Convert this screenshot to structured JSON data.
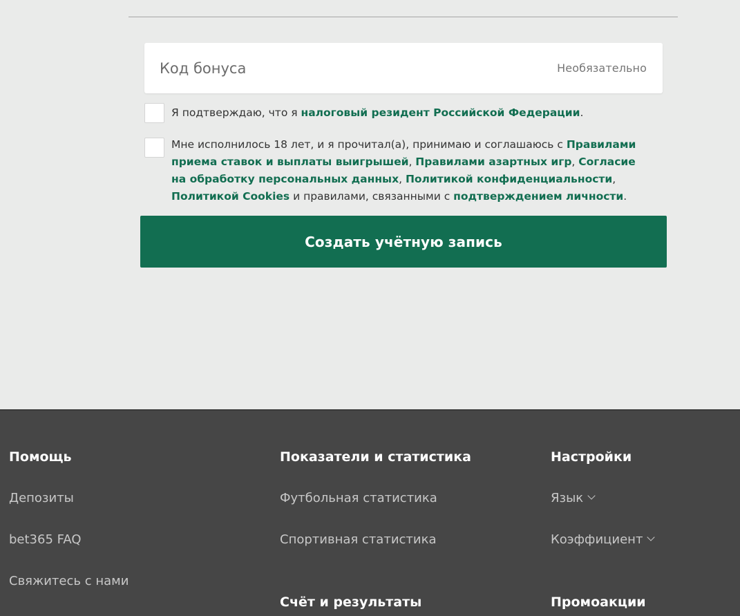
{
  "form": {
    "bonus_code": {
      "placeholder": "Код бонуса",
      "value": "",
      "optional_label": "Необязательно"
    },
    "tax_resident": {
      "checked": false,
      "text_before": "Я подтверждаю, что я ",
      "link": "налоговый резидент Российской Федерации",
      "text_after": "."
    },
    "age_consent": {
      "checked": false,
      "text_1": "Мне исполнилось 18 лет, и я прочитал(а), принимаю и соглашаюсь с ",
      "link_betting_rules": "Правилами приема ставок и выплаты выигрышей",
      "sep_1": ", ",
      "link_gambling_rules": "Правилами азартных игр",
      "sep_2": ", ",
      "link_data_consent": "Согласие на обработку персональных данных",
      "sep_3": ", ",
      "link_privacy": "Политикой конфиденциальности",
      "sep_4": ", ",
      "link_cookies": "Политикой Cookies",
      "text_2": " и правилами, связанными с ",
      "link_identity": "подтверждением личности",
      "text_3": "."
    },
    "submit_label": "Создать учётную запись"
  },
  "footer": {
    "help": {
      "heading": "Помощь",
      "links": [
        "Депозиты",
        "bet365 FAQ",
        "Свяжитесь с нами"
      ]
    },
    "stats": {
      "heading": "Показатели и статистика",
      "links": [
        "Футбольная статистика",
        "Спортивная статистика"
      ]
    },
    "scores": {
      "heading": "Счёт и результаты"
    },
    "settings": {
      "heading": "Настройки",
      "links": [
        "Язык",
        "Коэффициент"
      ]
    },
    "promos": {
      "heading": "Промоакции"
    }
  },
  "colors": {
    "brand_green": "#126e51",
    "page_bg": "#eaebea",
    "footer_bg": "#464646"
  }
}
